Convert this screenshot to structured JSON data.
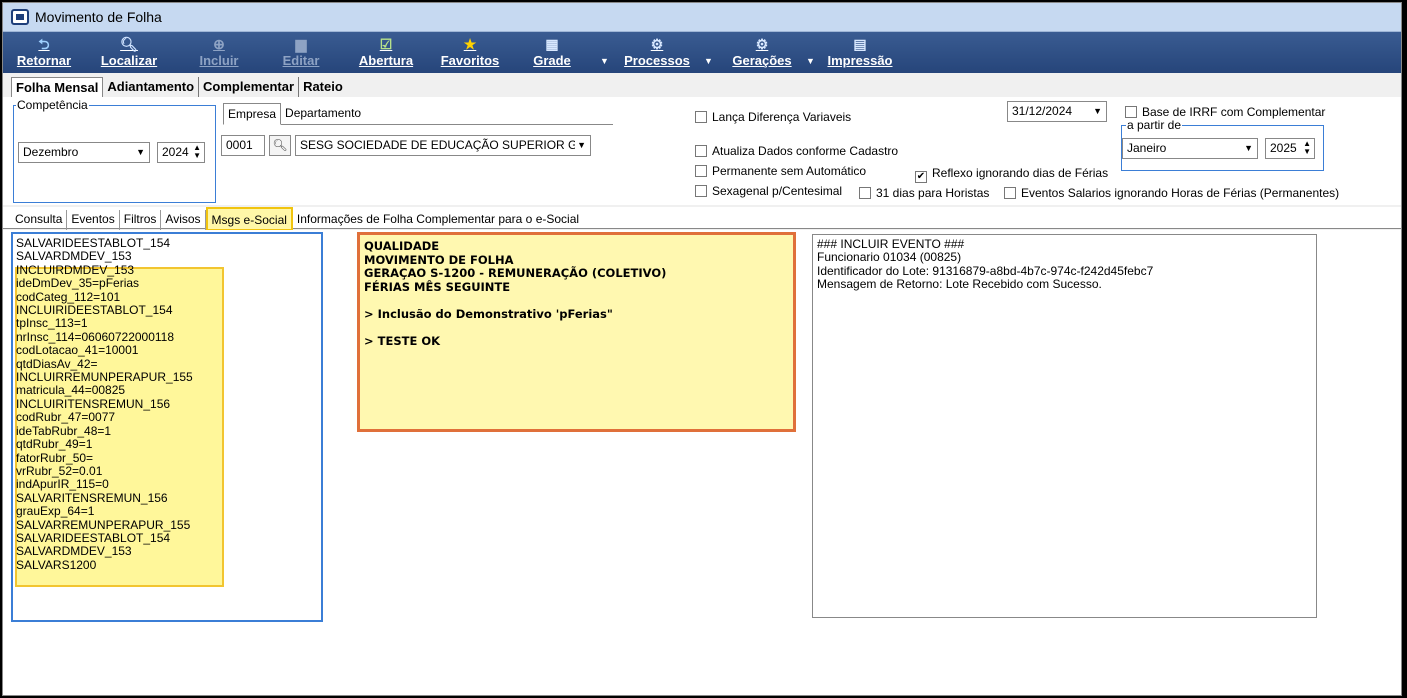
{
  "window": {
    "title": "Movimento de Folha"
  },
  "toolbar": {
    "buttons": [
      {
        "label": "Retornar",
        "icon": "return-arrow-icon",
        "enabled": true
      },
      {
        "label": "Localizar",
        "icon": "magnifier-icon",
        "enabled": true
      },
      {
        "label": "Incluir",
        "icon": "plus-circle-icon",
        "enabled": false
      },
      {
        "label": "Editar",
        "icon": "edit-icon",
        "enabled": false
      },
      {
        "label": "Abertura",
        "icon": "check-document-icon",
        "enabled": true
      },
      {
        "label": "Favoritos",
        "icon": "star-icon",
        "enabled": true
      },
      {
        "label": "Grade",
        "icon": "grid-icon",
        "enabled": true
      },
      {
        "label": "Processos",
        "icon": "process-icon",
        "enabled": true
      },
      {
        "label": "Gerações",
        "icon": "gear-icon",
        "enabled": true
      },
      {
        "label": "Impressão",
        "icon": "printer-icon",
        "enabled": true
      }
    ]
  },
  "main_tabs": [
    "Folha Mensal",
    "Adiantamento",
    "Complementar",
    "Rateio"
  ],
  "competencia": {
    "legend": "Competência",
    "month": "Dezembro",
    "year": "2024"
  },
  "empresa": {
    "tabs": [
      "Empresa",
      "Departamento"
    ],
    "code": "0001",
    "name": "SESG SOCIEDADE DE EDUCAÇÃO SUPERIOR G"
  },
  "options": {
    "lanca_diferenca": {
      "label": "Lança Diferença Variaveis",
      "checked": false
    },
    "atualiza_dados": {
      "label": "Atualiza Dados conforme Cadastro",
      "checked": false
    },
    "permanente": {
      "label": "Permanente sem Automático",
      "checked": false
    },
    "reflexo": {
      "label": "Reflexo ignorando dias de Férias",
      "checked": true
    },
    "sexagenal": {
      "label": "Sexagenal p/Centesimal",
      "checked": false
    },
    "dias31": {
      "label": "31 dias para Horistas",
      "checked": false
    },
    "eventos_salarios": {
      "label": "Eventos Salarios ignorando Horas de Férias (Permanentes)",
      "checked": false
    },
    "base_irrf": {
      "label": "Base de IRRF com Complementar",
      "checked": false
    }
  },
  "date": "31/12/2024",
  "a_partir_de": {
    "legend": "a partir de",
    "month": "Janeiro",
    "year": "2025"
  },
  "sub_tabs": [
    "Consulta",
    "Eventos",
    "Filtros",
    "Avisos",
    "Msgs e-Social",
    "Informações de Folha Complementar para o e-Social"
  ],
  "msg_lines": [
    "SALVARIDEESTABLOT_154",
    "SALVARDMDEV_153",
    "INCLUIRDMDEV_153",
    "ideDmDev_35=pFerias",
    "codCateg_112=101",
    "INCLUIRIDEESTABLOT_154",
    "tpInsc_113=1",
    "nrInsc_114=06060722000118",
    "codLotacao_41=10001",
    "qtdDiasAv_42=",
    "INCLUIRREMUNPERAPUR_155",
    "matricula_44=00825",
    "INCLUIRITENSREMUN_156",
    "codRubr_47=0077",
    "ideTabRubr_48=1",
    "qtdRubr_49=1",
    "fatorRubr_50=",
    "vrRubr_52=0.01",
    "indApurIR_115=0",
    "SALVARITENSREMUN_156",
    "grauExp_64=1",
    "SALVARREMUNPERAPUR_155",
    "SALVARIDEESTABLOT_154",
    "SALVARDMDEV_153",
    "SALVARS1200"
  ],
  "note_lines": [
    "QUALIDADE",
    "MOVIMENTO DE FOLHA",
    "GERAÇAO S-1200 - REMUNERAÇÃO (COLETIVO)",
    "FÉRIAS MÊS SEGUINTE",
    "",
    "> Inclusão do Demonstrativo 'pFerias\"",
    "",
    "> TESTE OK"
  ],
  "log_lines": [
    "### INCLUIR EVENTO ###",
    "Funcionario 01034 (00825)",
    "Identificador do Lote: 91316879-a8bd-4b7c-974c-f242d45febc7",
    "Mensagem de Retorno: Lote Recebido com Sucesso."
  ]
}
